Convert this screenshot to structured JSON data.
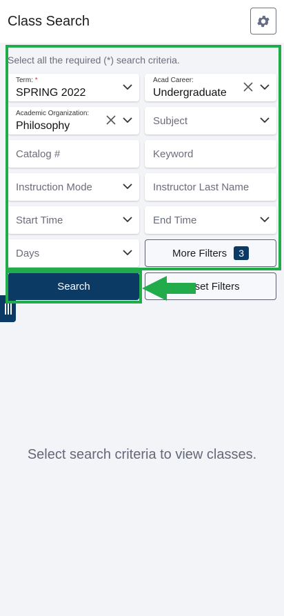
{
  "header": {
    "title": "Class Search",
    "settings_icon": "gear-icon"
  },
  "form": {
    "hint": "Select all the required (*) search criteria.",
    "term": {
      "label": "Term:",
      "required_mark": "*",
      "value": "SPRING 2022"
    },
    "acad_career": {
      "label": "Acad Career:",
      "value": "Undergraduate"
    },
    "academic_organization": {
      "label": "Academic Organization:",
      "value": "Philosophy"
    },
    "subject": {
      "placeholder": "Subject"
    },
    "catalog": {
      "placeholder": "Catalog #"
    },
    "keyword": {
      "placeholder": "Keyword"
    },
    "instruction_mode": {
      "placeholder": "Instruction Mode"
    },
    "instructor_last_name": {
      "placeholder": "Instructor Last Name"
    },
    "start_time": {
      "placeholder": "Start Time"
    },
    "end_time": {
      "placeholder": "End Time"
    },
    "days": {
      "placeholder": "Days"
    },
    "more_filters": {
      "label": "More Filters",
      "count": "3"
    }
  },
  "actions": {
    "search_label": "Search",
    "reset_label": "Reset Filters"
  },
  "results": {
    "empty_message": "Select search criteria to view classes."
  },
  "colors": {
    "primary": "#0b3a64",
    "highlight": "#22ab4a",
    "background": "#f3f4f8"
  }
}
